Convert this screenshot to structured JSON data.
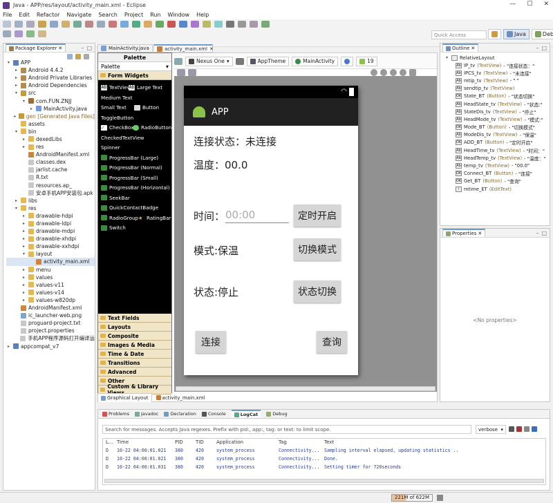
{
  "window": {
    "title": "Java - APP/res/layout/activity_main.xml - Eclipse",
    "controls": [
      "—",
      "☐",
      "✕"
    ]
  },
  "menu": [
    "File",
    "Edit",
    "Refactor",
    "Navigate",
    "Search",
    "Project",
    "Run",
    "Window",
    "Help"
  ],
  "quick_access": "Quick Access",
  "perspectives": [
    {
      "label": "Java",
      "active": true
    },
    {
      "label": "Debug",
      "active": false
    }
  ],
  "package_explorer": {
    "tab": "Package Explorer",
    "items": [
      {
        "label": "APP",
        "level": 0,
        "arrow": "▾",
        "icon": "project"
      },
      {
        "label": "Android 4.4.2",
        "level": 1,
        "arrow": "▸",
        "icon": "library"
      },
      {
        "label": "Android Private Libraries",
        "level": 1,
        "arrow": "▸",
        "icon": "library"
      },
      {
        "label": "Android Dependencies",
        "level": 1,
        "arrow": "▸",
        "icon": "library"
      },
      {
        "label": "src",
        "level": 1,
        "arrow": "▾",
        "icon": "src"
      },
      {
        "label": "com.FUN.ZNJJ",
        "level": 2,
        "arrow": "▾",
        "icon": "package"
      },
      {
        "label": "MainActivity.java",
        "level": 3,
        "arrow": "▸",
        "icon": "java"
      },
      {
        "label": "gen [Generated Java Files]",
        "level": 1,
        "arrow": "▸",
        "icon": "src"
      },
      {
        "label": "assets",
        "level": 1,
        "arrow": "",
        "icon": "folder"
      },
      {
        "label": "bin",
        "level": 1,
        "arrow": "▾",
        "icon": "folder"
      },
      {
        "label": "dexedLibs",
        "level": 2,
        "arrow": "▸",
        "icon": "folder"
      },
      {
        "label": "res",
        "level": 2,
        "arrow": "▸",
        "icon": "folder"
      },
      {
        "label": "AndroidManifest.xml",
        "level": 2,
        "arrow": "",
        "icon": "xml"
      },
      {
        "label": "classes.dex",
        "level": 2,
        "arrow": "",
        "icon": "file"
      },
      {
        "label": "jarlist.cache",
        "level": 2,
        "arrow": "",
        "icon": "file"
      },
      {
        "label": "R.txt",
        "level": 2,
        "arrow": "",
        "icon": "file"
      },
      {
        "label": "resources.ap_",
        "level": 2,
        "arrow": "",
        "icon": "file"
      },
      {
        "label": "安卓手机APP安装包.apk",
        "level": 2,
        "arrow": "",
        "icon": "file"
      },
      {
        "label": "libs",
        "level": 1,
        "arrow": "▸",
        "icon": "folder"
      },
      {
        "label": "res",
        "level": 1,
        "arrow": "▾",
        "icon": "folder"
      },
      {
        "label": "drawable-hdpi",
        "level": 2,
        "arrow": "▸",
        "icon": "folder"
      },
      {
        "label": "drawable-ldpi",
        "level": 2,
        "arrow": "▸",
        "icon": "folder"
      },
      {
        "label": "drawable-mdpi",
        "level": 2,
        "arrow": "▸",
        "icon": "folder"
      },
      {
        "label": "drawable-xhdpi",
        "level": 2,
        "arrow": "▸",
        "icon": "folder"
      },
      {
        "label": "drawable-xxhdpi",
        "level": 2,
        "arrow": "▸",
        "icon": "folder"
      },
      {
        "label": "layout",
        "level": 2,
        "arrow": "▾",
        "icon": "folder"
      },
      {
        "label": "activity_main.xml",
        "level": 3,
        "arrow": "",
        "icon": "xml",
        "selected": true
      },
      {
        "label": "menu",
        "level": 2,
        "arrow": "▸",
        "icon": "folder"
      },
      {
        "label": "values",
        "level": 2,
        "arrow": "▸",
        "icon": "folder"
      },
      {
        "label": "values-v11",
        "level": 2,
        "arrow": "▸",
        "icon": "folder"
      },
      {
        "label": "values-v14",
        "level": 2,
        "arrow": "▸",
        "icon": "folder"
      },
      {
        "label": "values-w820dp",
        "level": 2,
        "arrow": "▸",
        "icon": "folder"
      },
      {
        "label": "AndroidManifest.xml",
        "level": 1,
        "arrow": "",
        "icon": "xml"
      },
      {
        "label": "ic_launcher-web.png",
        "level": 1,
        "arrow": "",
        "icon": "image"
      },
      {
        "label": "proguard-project.txt",
        "level": 1,
        "arrow": "",
        "icon": "file"
      },
      {
        "label": "project.properties",
        "level": 1,
        "arrow": "",
        "icon": "file"
      },
      {
        "label": "手机APP程序源码打开编译运",
        "level": 1,
        "arrow": "",
        "icon": "file"
      },
      {
        "label": "appcompat_v7",
        "level": 0,
        "arrow": "▸",
        "icon": "project"
      }
    ]
  },
  "editor_tabs": [
    {
      "label": "MainActivity.java",
      "selected": false
    },
    {
      "label": "activity_main.xml",
      "selected": true
    }
  ],
  "palette": {
    "title": "Palette",
    "selector": "Palette",
    "open_section": "Form Widgets",
    "widgets": [
      {
        "label": "TextView",
        "icon": "tv"
      },
      {
        "label": "Large Text",
        "icon": "tv"
      },
      {
        "label": "Medium Text",
        "icon": "none"
      },
      {
        "label": "Small Text",
        "icon": "none"
      },
      {
        "label": "Button",
        "icon": "btn"
      },
      {
        "label": "ToggleButton",
        "icon": "none"
      },
      {
        "label": "CheckBox",
        "icon": "check"
      },
      {
        "label": "RadioButton",
        "icon": "radio"
      },
      {
        "label": "CheckedTextView",
        "icon": "none"
      },
      {
        "label": "Spinner",
        "icon": "none"
      },
      {
        "label": "ProgressBar (Large)",
        "icon": "bar"
      },
      {
        "label": "ProgressBar (Normal)",
        "icon": "bar"
      },
      {
        "label": "ProgressBar (Small)",
        "icon": "bar"
      },
      {
        "label": "ProgressBar (Horizontal)",
        "icon": "bar"
      },
      {
        "label": "SeekBar",
        "icon": "bar"
      },
      {
        "label": "QuickContactBadge",
        "icon": "bar"
      },
      {
        "label": "RadioGroup",
        "icon": "bar"
      },
      {
        "label": "RatingBar",
        "icon": "star"
      },
      {
        "label": "Switch",
        "icon": "bar"
      }
    ],
    "sections": [
      "Text Fields",
      "Layouts",
      "Composite",
      "Images & Media",
      "Time & Date",
      "Transitions",
      "Advanced",
      "Other",
      "Custom & Library Views"
    ]
  },
  "layout_toolbar": {
    "device": "Nexus One",
    "theme": "AppTheme",
    "activity": "MainActivity",
    "api": "19"
  },
  "phone": {
    "app_title": "APP",
    "connect_status": "连接状态：未连接",
    "temperature": "温度：00.0",
    "time_label": "时间：",
    "time_hint": "00:00",
    "timer_button": "定时开启",
    "mode_label": "模式:保温",
    "mode_button": "切换模式",
    "state_label": "状态:停止",
    "state_button": "状态切换",
    "connect_button": "连接",
    "query_button": "查询"
  },
  "bottom_tabs": [
    "Graphical Layout",
    "activity_main.xml"
  ],
  "outline": {
    "tab": "Outline",
    "root": "RelativeLayout",
    "items": [
      {
        "id": "IP_tv",
        "type": "(TextView)",
        "text": "- \"连接状态：\""
      },
      {
        "id": "IPCS_tv",
        "type": "(TextView)",
        "text": "- \"未连接\""
      },
      {
        "id": "mtip_tv",
        "type": "(TextView)",
        "text": "- \" \""
      },
      {
        "id": "sendtip_tv",
        "type": "(TextView)",
        "text": ""
      },
      {
        "id": "State_BT",
        "type": "(Button)",
        "text": "- \"状态切换\""
      },
      {
        "id": "HeadState_tv",
        "type": "(TextView)",
        "text": "- \"状态:\""
      },
      {
        "id": "StateDis_tv",
        "type": "(TextView)",
        "text": "- \"停止\""
      },
      {
        "id": "HeadMode_tv",
        "type": "(TextView)",
        "text": "- \"模式:\""
      },
      {
        "id": "Mode_BT",
        "type": "(Button)",
        "text": "- \"切换模式\""
      },
      {
        "id": "ModeDis_tv",
        "type": "(TextView)",
        "text": "- \"保温\""
      },
      {
        "id": "ADD_BT",
        "type": "(Button)",
        "text": "- \"定时开启\""
      },
      {
        "id": "HeadTime_tv",
        "type": "(TextView)",
        "text": "- \"时间：\""
      },
      {
        "id": "HeadTemp_tv",
        "type": "(TextView)",
        "text": "- \"温度：\""
      },
      {
        "id": "temp_tv",
        "type": "(TextView)",
        "text": "- \"00.0\""
      },
      {
        "id": "Connect_BT",
        "type": "(Button)",
        "text": "- \"连接\""
      },
      {
        "id": "Get_BT",
        "type": "(Button)",
        "text": "- \"查询\""
      },
      {
        "id": "mtime_ET",
        "type": "(EditText)",
        "text": ""
      }
    ]
  },
  "properties": {
    "tab": "Properties",
    "empty": "<No properties>"
  },
  "console": {
    "tabs": [
      "Problems",
      "Javadoc",
      "Declaration",
      "Console",
      "LogCat",
      "Debug"
    ],
    "active_tab": "LogCat",
    "search_placeholder": "Search for messages. Accepts Java regexes. Prefix with pid:, app:, tag: or text: to limit scope.",
    "level": "verbose",
    "columns": [
      "L...",
      "Time",
      "PID",
      "TID",
      "Application",
      "Tag",
      "Text"
    ],
    "rows": [
      [
        "D",
        "10-22 04:00:01.021",
        "380",
        "420",
        "system_process",
        "Connectivity...",
        "Sampling interval elapsed, updating statistics .."
      ],
      [
        "D",
        "10-22 04:00:01.021",
        "380",
        "420",
        "system_process",
        "Connectivity...",
        "Done."
      ],
      [
        "D",
        "10-22 04:00:01.031",
        "380",
        "420",
        "system_process",
        "Connectivity...",
        "Setting timer for 720seconds"
      ]
    ]
  },
  "statusbar": {
    "memory": "221M of 622M",
    "memory_fraction": 0.355
  },
  "colors": {
    "accent": "#6e9bd0",
    "palette_bg": "#000000",
    "section_bg": "#f0e5c6",
    "logcat_text": "#1a3cae",
    "appbar": "#212121"
  }
}
